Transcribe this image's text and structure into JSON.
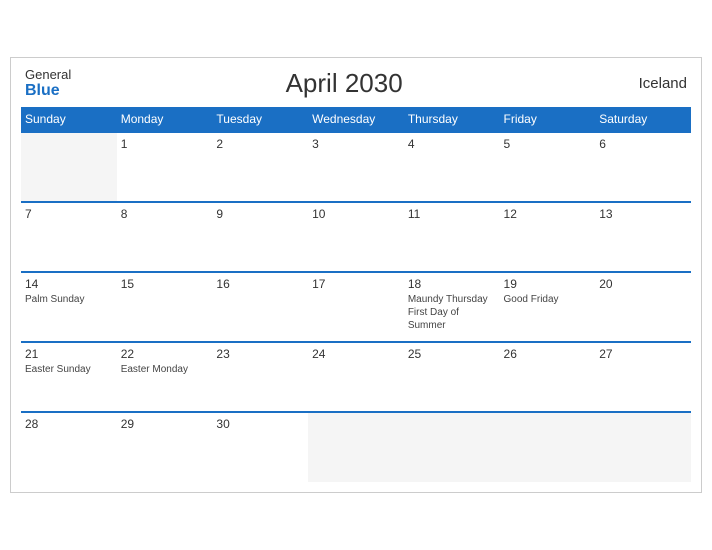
{
  "header": {
    "logo_general": "General",
    "logo_blue": "Blue",
    "title": "April 2030",
    "country": "Iceland"
  },
  "weekdays": [
    "Sunday",
    "Monday",
    "Tuesday",
    "Wednesday",
    "Thursday",
    "Friday",
    "Saturday"
  ],
  "weeks": [
    [
      {
        "day": "",
        "events": []
      },
      {
        "day": "1",
        "events": []
      },
      {
        "day": "2",
        "events": []
      },
      {
        "day": "3",
        "events": []
      },
      {
        "day": "4",
        "events": []
      },
      {
        "day": "5",
        "events": []
      },
      {
        "day": "6",
        "events": []
      }
    ],
    [
      {
        "day": "7",
        "events": []
      },
      {
        "day": "8",
        "events": []
      },
      {
        "day": "9",
        "events": []
      },
      {
        "day": "10",
        "events": []
      },
      {
        "day": "11",
        "events": []
      },
      {
        "day": "12",
        "events": []
      },
      {
        "day": "13",
        "events": []
      }
    ],
    [
      {
        "day": "14",
        "events": [
          "Palm Sunday"
        ]
      },
      {
        "day": "15",
        "events": []
      },
      {
        "day": "16",
        "events": []
      },
      {
        "day": "17",
        "events": []
      },
      {
        "day": "18",
        "events": [
          "Maundy Thursday",
          "First Day of Summer"
        ]
      },
      {
        "day": "19",
        "events": [
          "Good Friday"
        ]
      },
      {
        "day": "20",
        "events": []
      }
    ],
    [
      {
        "day": "21",
        "events": [
          "Easter Sunday"
        ]
      },
      {
        "day": "22",
        "events": [
          "Easter Monday"
        ]
      },
      {
        "day": "23",
        "events": []
      },
      {
        "day": "24",
        "events": []
      },
      {
        "day": "25",
        "events": []
      },
      {
        "day": "26",
        "events": []
      },
      {
        "day": "27",
        "events": []
      }
    ],
    [
      {
        "day": "28",
        "events": []
      },
      {
        "day": "29",
        "events": []
      },
      {
        "day": "30",
        "events": []
      },
      {
        "day": "",
        "events": []
      },
      {
        "day": "",
        "events": []
      },
      {
        "day": "",
        "events": []
      },
      {
        "day": "",
        "events": []
      }
    ]
  ]
}
